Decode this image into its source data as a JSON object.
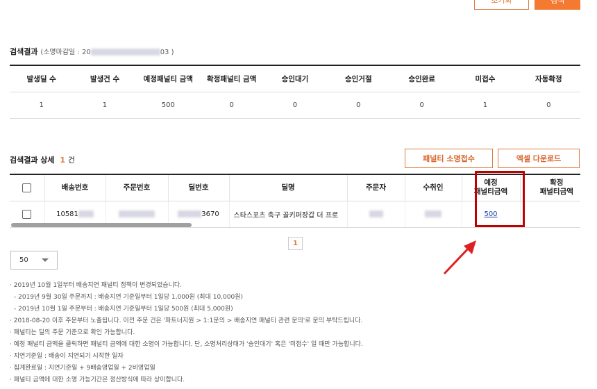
{
  "top_buttons": {
    "outline_label": "초기화",
    "fill_label": "검색"
  },
  "search_result": {
    "title": "검색결과",
    "cutoff_prefix": "(소명마감일 : 20",
    "cutoff_suffix": "03 )"
  },
  "summary": {
    "headers": [
      "발생딜 수",
      "발생건 수",
      "예정패널티 금액",
      "확정패널티 금액",
      "승인대기",
      "승인거절",
      "승인완료",
      "미접수",
      "자동확정"
    ],
    "values": [
      "1",
      "1",
      "500",
      "0",
      "0",
      "0",
      "0",
      "1",
      "0"
    ]
  },
  "detail": {
    "title": "검색결과 상세",
    "count": "1",
    "count_unit": "건",
    "buttons": {
      "penalty_appeal": "패널티 소명접수",
      "excel_download": "엑셀 다운로드"
    },
    "headers": {
      "shipping_no": "배송번호",
      "order_no": "주문번호",
      "deal_no": "딜번호",
      "deal_name": "딜명",
      "orderer": "주문자",
      "recipient": "수취인",
      "expected_penalty_line1": "예정",
      "expected_penalty_line2": "패널티금액",
      "confirmed_penalty_line1": "확정",
      "confirmed_penalty_line2": "패널티금액"
    },
    "row": {
      "shipping_no": "10581",
      "deal_no_suffix": "3670",
      "deal_name": "스타스포츠 축구 골키퍼장갑 더 프로",
      "expected_penalty": "500"
    }
  },
  "pagination": {
    "current": "1"
  },
  "page_size": {
    "value": "50"
  },
  "notes": [
    "· 2019년 10월 1일부터 배송지연 패널티 정책이 변경되었습니다.",
    "- 2019년 9월 30일 주문까지 : 배송지연 기준일부터 1일당 1,000원 (최대 10,000원)",
    "- 2019년 10월 1일 주문부터 : 배송지연 기준일부터 1일당 500원 (최대 5,000원)",
    "· 2018-08-20 이후 주문부터 노출됩니다. 이전 주문 건은 '파트너지원 > 1:1문의 > 배송지연 패널티 관련 문의'로 문의 부탁드립니다.",
    "· 패널티는 딜의 주문 기준으로 확인 가능합니다.",
    "· 예정 패널티 금액을 클릭하면 패널티 금액에 대한 소명이 가능합니다. 단, 소명처리상태가 '승인대기' 혹은 '미접수' 일 때만 가능합니다.",
    "· 지연기준일 : 배송이 지연되기 시작한 일자",
    "· 집계완료일 : 지연기준일 + 9배송영업일 + 2비영업일",
    "· 패널티 금액에 대한 소명 가능기간은 정산방식에 따라 상이합니다."
  ],
  "colors": {
    "accent": "#f47a32",
    "highlight": "#c00000",
    "link": "#1a3fa8"
  }
}
